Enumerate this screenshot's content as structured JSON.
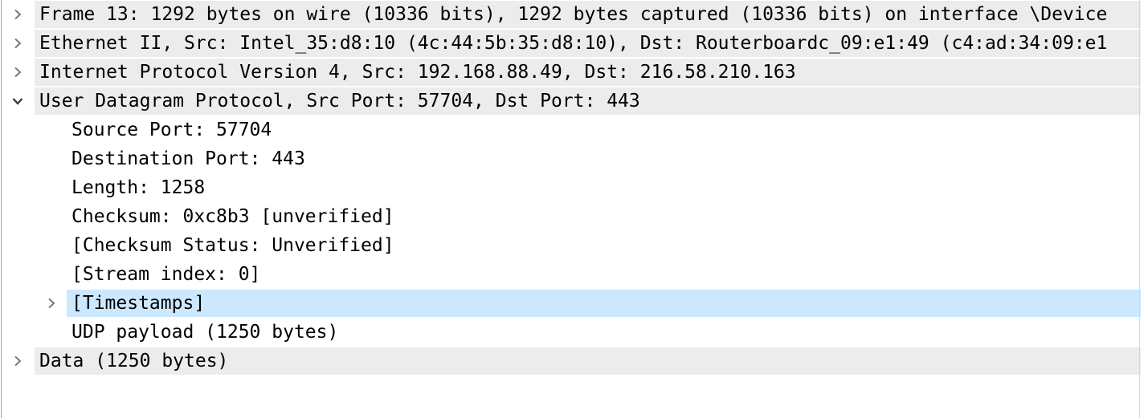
{
  "packet_details": {
    "rows": [
      {
        "label": "Frame 13: 1292 bytes on wire (10336 bits), 1292 bytes captured (10336 bits) on interface \\Device",
        "expanded": false
      },
      {
        "label": "Ethernet II, Src: Intel_35:d8:10 (4c:44:5b:35:d8:10), Dst: Routerboardc_09:e1:49 (c4:ad:34:09:e1",
        "expanded": false
      },
      {
        "label": "Internet Protocol Version 4, Src: 192.168.88.49, Dst: 216.58.210.163",
        "expanded": false
      },
      {
        "label": "User Datagram Protocol, Src Port: 57704, Dst Port: 443",
        "expanded": true
      },
      {
        "label": "Source Port: 57704"
      },
      {
        "label": "Destination Port: 443"
      },
      {
        "label": "Length: 1258"
      },
      {
        "label": "Checksum: 0xc8b3 [unverified]"
      },
      {
        "label": "[Checksum Status: Unverified]"
      },
      {
        "label": "[Stream index: 0]"
      },
      {
        "label": "[Timestamps]",
        "expanded": false,
        "selected": true
      },
      {
        "label": "UDP payload (1250 bytes)"
      },
      {
        "label": "Data (1250 bytes)",
        "expanded": false
      }
    ]
  },
  "colors": {
    "header_row_bg": "#ececec",
    "selected_row_bg": "#cce8ff",
    "text": "#000000",
    "toggle_icon": "#7a7a7a"
  }
}
